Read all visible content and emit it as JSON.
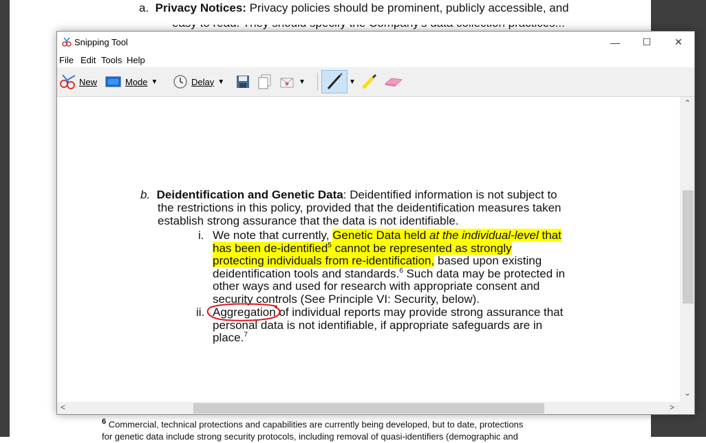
{
  "background_doc": {
    "top_item": "a.",
    "top_bold": "Privacy Notices:",
    "top_text": " Privacy policies should be prominent, publicly accessible, and",
    "top_cut_text": "easy to read. They should specify the Company's data collection practices...",
    "footnote_num": "6",
    "footnote_line1": " Commercial, technical protections and capabilities are currently being developed, but to date, protections",
    "footnote_line2": "for genetic data include strong security protocols, including removal of quasi-identifiers (demographic and"
  },
  "window": {
    "title": "Snipping Tool",
    "controls": {
      "minimize": "—",
      "maximize": "☐",
      "close": "✕"
    }
  },
  "menu": {
    "file": "File",
    "edit": "Edit",
    "tools": "Tools",
    "help": "Help"
  },
  "toolbar": {
    "new": "New",
    "mode": "Mode",
    "delay": "Delay"
  },
  "captured": {
    "b_marker": "b.",
    "b_title": "Deidentification and Genetic Data",
    "b_colon": ": Deidentified information is not subject to",
    "b_line2": "the restrictions in this policy, provided that the deidentification measures taken",
    "b_line3": "establish strong assurance that the data is not identifiable.",
    "i_marker": "i.",
    "i_pre": "We note that currently, ",
    "i_hl1a": "Genetic Data held ",
    "i_hl1_italic": "at the individual-level",
    "i_hl1b": " that",
    "i_hl2a": "has been de-identified",
    "i_sup5": "5",
    "i_hl2b": " cannot be represented as strongly",
    "i_hl3": "protecting individuals from re-identification,",
    "i_l3rest": " based upon existing",
    "i_l4": "deidentification tools and standards.",
    "i_sup6": "6",
    "i_l4rest": " Such data may be protected in",
    "i_l5": "other ways and used for research with appropriate consent and",
    "i_l6": "security controls (See Principle VI: Security, below).",
    "ii_marker": "ii.",
    "ii_word": "Aggregation",
    "ii_rest": " of individual reports may provide strong assurance that",
    "ii_l2": "personal data is not identifiable, if appropriate safeguards are in",
    "ii_l3": "place.",
    "ii_sup7": "7"
  },
  "colors": {
    "highlight": "#ffff00",
    "annotation_pen": "#e0151b",
    "titlebar": "#ffffff",
    "toolbar": "#f0f0f0"
  }
}
